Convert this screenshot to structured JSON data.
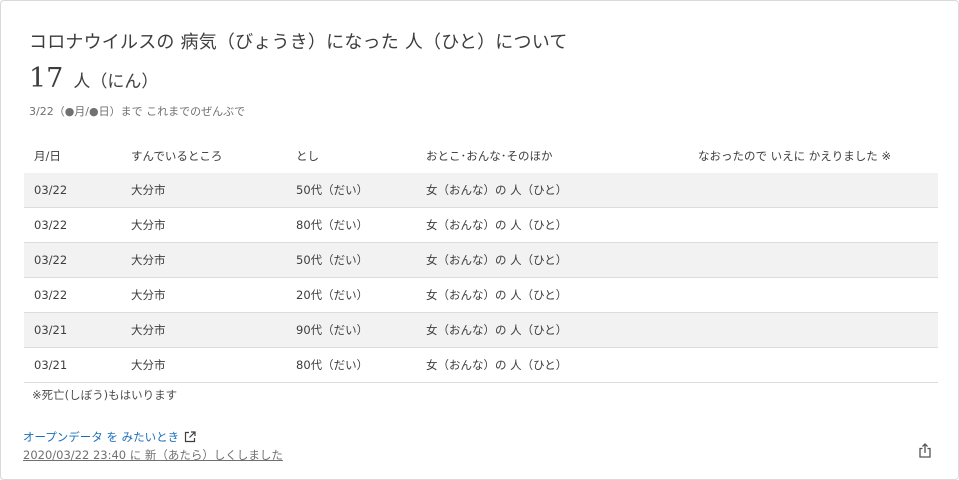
{
  "card": {
    "title": "コロナウイルスの 病気（びょうき）になった 人（ひと）について",
    "summary_number": "17",
    "summary_unit": "人（にん）",
    "date_note": "3/22（●月/●日）まで これまでのぜんぶで"
  },
  "table": {
    "headers": [
      "月/日",
      "すんでいるところ",
      "とし",
      "おとこ･おんな･そのほか",
      "なおったので いえに かえりました ※"
    ],
    "rows": [
      {
        "date": "03/22",
        "place": "大分市",
        "age": "50代（だい）",
        "sex": "女（おんな）の 人（ひと）",
        "recovered": ""
      },
      {
        "date": "03/22",
        "place": "大分市",
        "age": "80代（だい）",
        "sex": "女（おんな）の 人（ひと）",
        "recovered": ""
      },
      {
        "date": "03/22",
        "place": "大分市",
        "age": "50代（だい）",
        "sex": "女（おんな）の 人（ひと）",
        "recovered": ""
      },
      {
        "date": "03/22",
        "place": "大分市",
        "age": "20代（だい）",
        "sex": "女（おんな）の 人（ひと）",
        "recovered": ""
      },
      {
        "date": "03/21",
        "place": "大分市",
        "age": "90代（だい）",
        "sex": "女（おんな）の 人（ひと）",
        "recovered": ""
      },
      {
        "date": "03/21",
        "place": "大分市",
        "age": "80代（だい）",
        "sex": "女（おんな）の 人（ひと）",
        "recovered": ""
      }
    ]
  },
  "footer": {
    "footnote": "※死亡(しぼう)もはいります",
    "opendata_link": "オープンデータ を みたいとき",
    "updated": "2020/03/22 23:40 に 新（あたら）しくしました"
  },
  "icons": {
    "external_link": "external-link-icon",
    "share": "share-icon"
  },
  "colors": {
    "link": "#1a6fb8",
    "alt_row": "#f2f2f2",
    "text": "#3d3d3d"
  }
}
